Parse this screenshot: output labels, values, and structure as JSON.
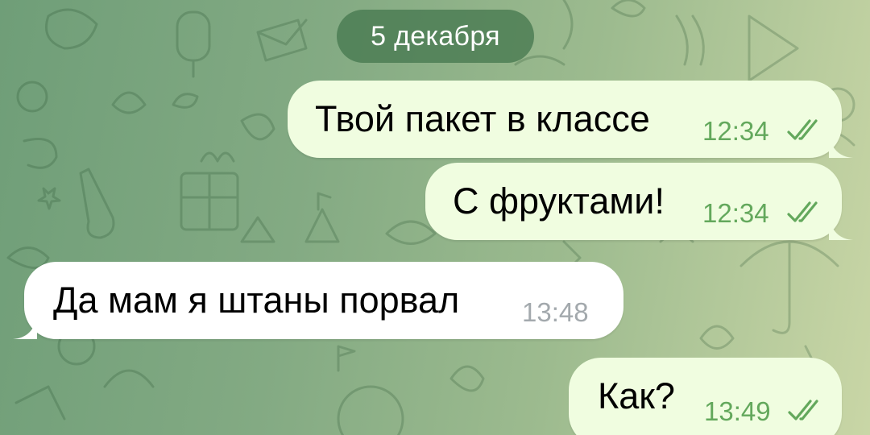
{
  "chat": {
    "date_label": "5 декабря",
    "messages": [
      {
        "direction": "out",
        "text": "Твой пакет в классе",
        "time": "12:34",
        "status": "read"
      },
      {
        "direction": "out",
        "text": "С фруктами!",
        "time": "12:34",
        "status": "read"
      },
      {
        "direction": "in",
        "text": "Да мам я штаны порвал",
        "time": "13:48"
      },
      {
        "direction": "out",
        "text": "Как?",
        "time": "13:49",
        "status": "read"
      }
    ]
  },
  "colors": {
    "outgoing_bubble": "#f0fde0",
    "incoming_bubble": "#ffffff",
    "outgoing_time": "#63a85c",
    "incoming_time": "#a3a9ad",
    "date_pill": "#467850",
    "background": "#83aa83"
  },
  "icons": {
    "read_status": "double-check-icon",
    "bubble_tail": "bubble-tail-icon",
    "wallpaper": "doodle-pattern"
  }
}
